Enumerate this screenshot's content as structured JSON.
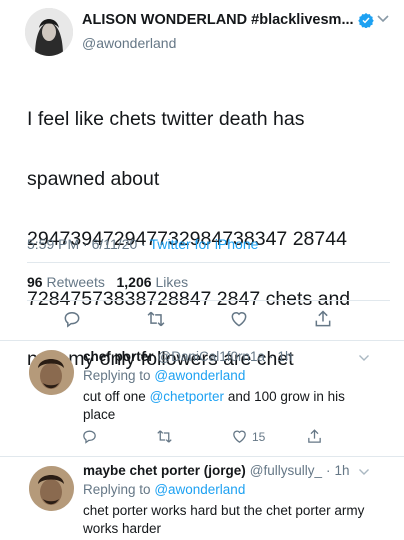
{
  "main_tweet": {
    "display_name": "ALISON WONDERLAND #blacklivesm...",
    "handle": "@awonderland",
    "text": "I feel like chets twitter death has spawned about 2947394729477329847383472874472847573838728847284 7 chets and now my only followers are chet",
    "text_lines": [
      "I feel like chets twitter death has",
      "spawned about",
      "294739472947732984738347 28744",
      "72847573838728847 2847 chets and",
      "now my only followers are chet"
    ],
    "time": "5:59 PM",
    "date": "6/11/20",
    "separator": "·",
    "source": "Twitter for iPhone",
    "retweets_count": "96",
    "retweets_label": "Retweets",
    "likes_count": "1,206",
    "likes_label": "Likes"
  },
  "replies": [
    {
      "display_name": "chef porter",
      "handle": "@DaniCal1f0rn1a",
      "separator": "·",
      "time": "1h",
      "replying_prefix": "Replying to",
      "replying_to": "@awonderland",
      "text_before": "cut off one ",
      "text_mention": "@chetporter",
      "text_after": " and 100 grow in his place",
      "likes": "15"
    },
    {
      "display_name": "maybe chet porter (jorge)",
      "handle": "@fullysully_",
      "separator": "·",
      "time": "1h",
      "replying_prefix": "Replying to",
      "replying_to": "@awonderland",
      "text": "chet porter works hard but the chet porter army works harder"
    }
  ],
  "icons": {
    "verified": "verified-badge-icon",
    "caret": "chevron-down-icon",
    "reply": "reply-icon",
    "retweet": "retweet-icon",
    "like": "heart-icon",
    "share": "share-icon"
  },
  "colors": {
    "accent": "#1da1f2",
    "secondary_text": "#657786",
    "primary_text": "#14171a",
    "divider": "#e1e8ed"
  }
}
